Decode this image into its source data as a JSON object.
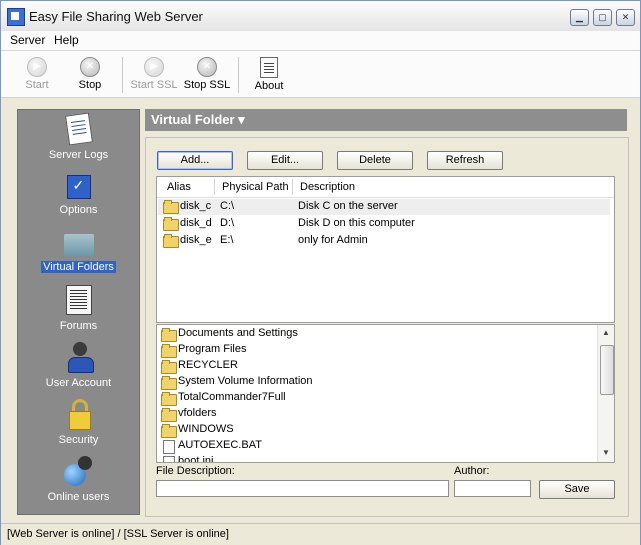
{
  "window": {
    "title": "Easy File Sharing Web Server",
    "minimize_icon": "minimize-icon",
    "maximize_icon": "maximize-icon",
    "close_icon": "close-icon"
  },
  "menu": {
    "items": [
      {
        "label": "Server"
      },
      {
        "label": "Help"
      }
    ]
  },
  "toolbar": {
    "start_label": "Start",
    "stop_label": "Stop",
    "start_ssl_label": "Start SSL",
    "stop_ssl_label": "Stop SSL",
    "about_label": "About"
  },
  "sidebar": {
    "items": [
      {
        "label": "Server Logs",
        "icon": "server-logs-icon"
      },
      {
        "label": "Options",
        "icon": "options-icon"
      },
      {
        "label": "Virtual Folders",
        "icon": "virtual-folders-icon",
        "selected": true
      },
      {
        "label": "Forums",
        "icon": "forums-icon"
      },
      {
        "label": "User Account",
        "icon": "user-account-icon"
      },
      {
        "label": "Security",
        "icon": "security-icon"
      },
      {
        "label": "Online users",
        "icon": "online-users-icon"
      }
    ]
  },
  "main": {
    "header_title": "Virtual Folder ▾",
    "buttons": {
      "add": "Add...",
      "edit": "Edit...",
      "delete": "Delete",
      "refresh": "Refresh"
    },
    "table": {
      "columns": [
        "Alias",
        "Physical Path",
        "Description"
      ],
      "rows": [
        {
          "alias": "disk_c",
          "path": "C:\\",
          "description": "Disk C on the server"
        },
        {
          "alias": "disk_d",
          "path": "D:\\",
          "description": "Disk D on this computer"
        },
        {
          "alias": "disk_e",
          "path": "E:\\",
          "description": "only for Admin"
        }
      ]
    },
    "filesystem": [
      {
        "name": "Documents and Settings",
        "type": "folder"
      },
      {
        "name": "Program Files",
        "type": "folder"
      },
      {
        "name": "RECYCLER",
        "type": "folder"
      },
      {
        "name": "System Volume Information",
        "type": "folder"
      },
      {
        "name": "TotalCommander7Full",
        "type": "folder"
      },
      {
        "name": "vfolders",
        "type": "folder"
      },
      {
        "name": "WINDOWS",
        "type": "folder"
      },
      {
        "name": "AUTOEXEC.BAT",
        "type": "file"
      },
      {
        "name": "boot.ini",
        "type": "file"
      }
    ],
    "file_description_label": "File Description:",
    "file_description_value": "",
    "author_label": "Author:",
    "author_value": "",
    "save_label": "Save"
  },
  "status": {
    "text": "[Web Server is online] / [SSL Server is online]"
  }
}
